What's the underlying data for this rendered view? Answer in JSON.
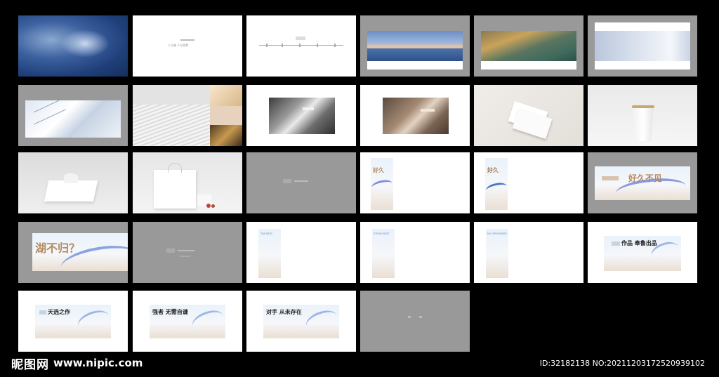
{
  "slide_texts": {
    "s2_title": "人与湖 人与世界",
    "s20_title": "好久不见",
    "s21_title": "湖不归？",
    "s23_heading": "THE BEST",
    "s24_heading": "STRIVE BEST",
    "s25_heading": "NO OPPONENTS",
    "s26_title": "作品 奉鲁出品",
    "s27_title": "天选之作",
    "s28_title": "强者 无需自谦",
    "s29_title": "对手 从未存在"
  },
  "watermark": {
    "brand": "昵图网",
    "url": "www.nipic.com",
    "id_text": "ID:32182138 NO:20211203172520939102"
  }
}
